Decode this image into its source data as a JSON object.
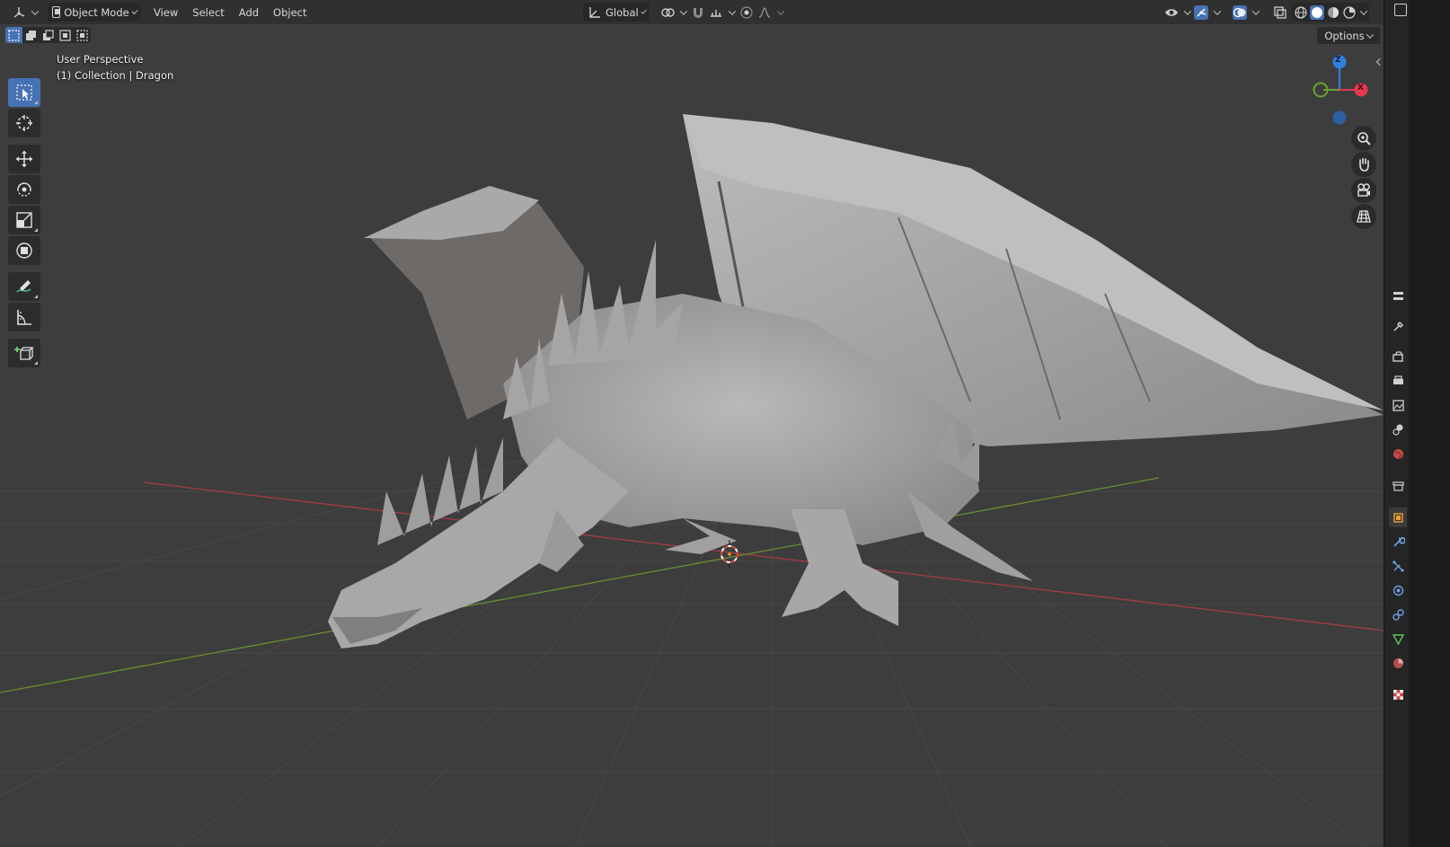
{
  "header": {
    "editor_type_icon": "3d-viewport-icon",
    "mode_label": "Object Mode",
    "menus": [
      "View",
      "Select",
      "Add",
      "Object"
    ],
    "orientation_label": "Global"
  },
  "subheader": {
    "options_label": "Options"
  },
  "viewport": {
    "perspective_label": "User Perspective",
    "collection_label": "(1) Collection | Dragon",
    "gizmo": {
      "z_label": "Z",
      "x_label": "X"
    }
  },
  "colors": {
    "accent": "#4772b3",
    "header_bg": "#303030",
    "viewport_bg": "#3d3d3d",
    "grid_line": "#474747",
    "x_axis": "#a83a44",
    "y_axis": "#6a8f2e",
    "gizmo_x": "#e33a4f",
    "gizmo_y": "#6aa32d",
    "gizmo_z": "#2f7fde"
  },
  "toolbar": {
    "tools": [
      "select-box",
      "cursor",
      "move",
      "rotate",
      "scale",
      "transform",
      "annotate",
      "measure",
      "add-cube"
    ]
  },
  "properties_tabs": [
    "tool",
    "render",
    "output",
    "view-layer",
    "scene",
    "world",
    "collection",
    "object",
    "modifiers",
    "particles",
    "physics",
    "constraints",
    "data",
    "material",
    "texture"
  ]
}
